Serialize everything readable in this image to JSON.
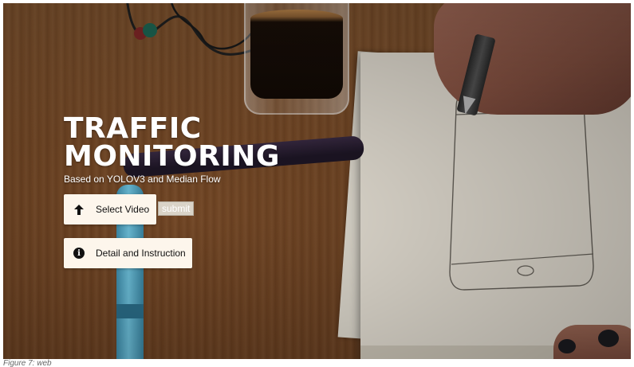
{
  "hero": {
    "title_line1": "TRAFFIC",
    "title_line2": "MONITORING",
    "subtitle": "Based on YOLOV3 and Median Flow"
  },
  "actions": {
    "select_video_label": "Select Video",
    "select_video_icon": "arrow-up-icon",
    "submit_label": "submit",
    "detail_label": "Detail and Instruction",
    "detail_icon": "info-icon",
    "info_glyph": "i"
  },
  "caption": {
    "text": "Figure 7: web"
  },
  "colors": {
    "button_bg": "#fdf6ec",
    "title_text": "#ffffff",
    "submit_bg": "#d9d3c7"
  }
}
